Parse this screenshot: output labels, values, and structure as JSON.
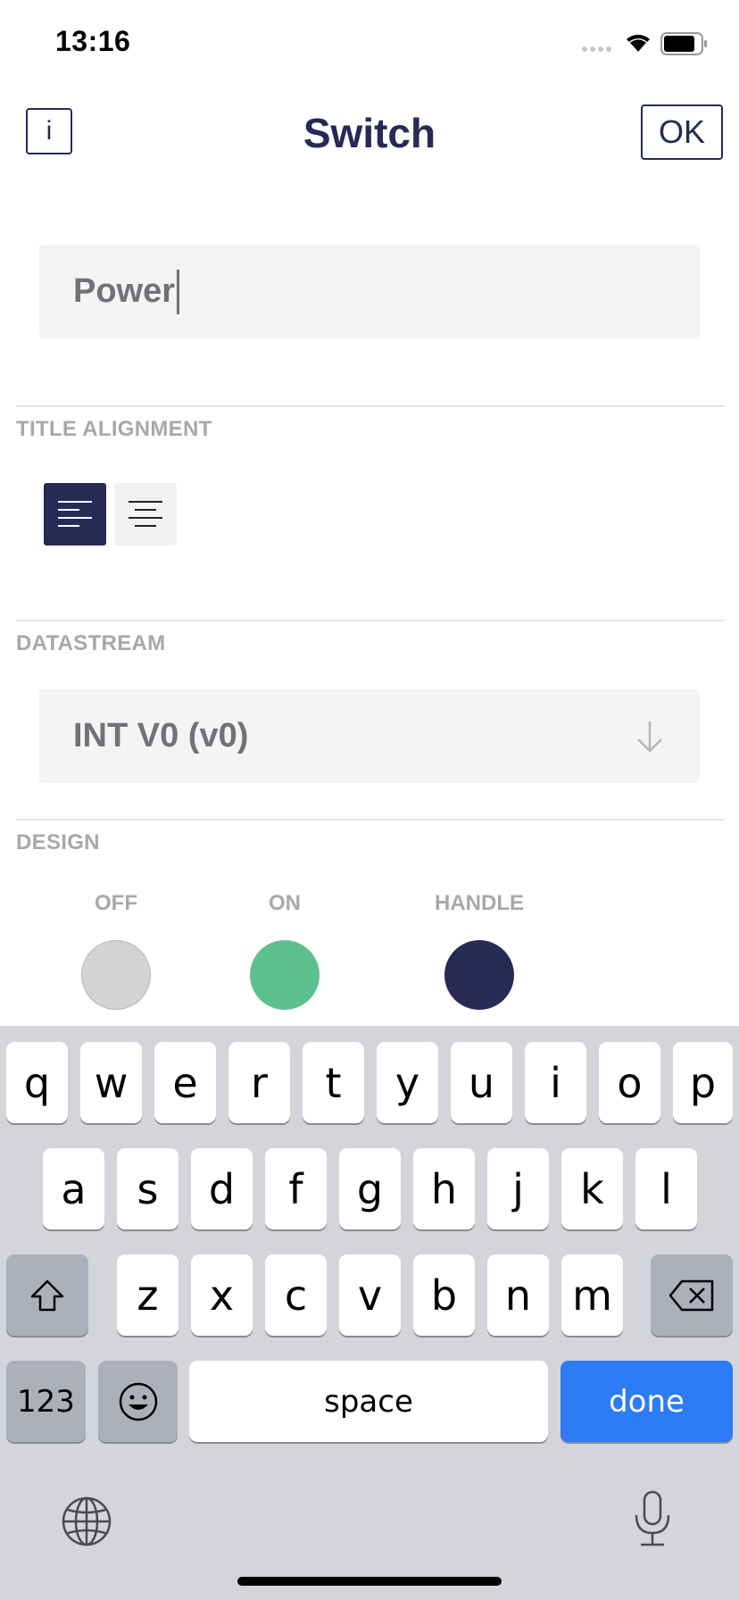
{
  "status_bar": {
    "time": "13:16"
  },
  "header": {
    "info_label": "i",
    "title": "Switch",
    "ok_label": "OK"
  },
  "title_field": {
    "value": "Power"
  },
  "title_alignment": {
    "label": "TITLE ALIGNMENT",
    "options": [
      "left",
      "center"
    ],
    "selected": "left"
  },
  "datastream": {
    "label": "DATASTREAM",
    "value": "INT V0 (v0)"
  },
  "design": {
    "label": "DESIGN",
    "swatches": [
      {
        "label": "OFF",
        "color": "#d3d3d3"
      },
      {
        "label": "ON",
        "color": "#5dc08e"
      },
      {
        "label": "HANDLE",
        "color": "#262a55"
      }
    ]
  },
  "keyboard": {
    "row1": [
      "q",
      "w",
      "e",
      "r",
      "t",
      "y",
      "u",
      "i",
      "o",
      "p"
    ],
    "row2": [
      "a",
      "s",
      "d",
      "f",
      "g",
      "h",
      "j",
      "k",
      "l"
    ],
    "row3": [
      "z",
      "x",
      "c",
      "v",
      "b",
      "n",
      "m"
    ],
    "numbers_label": "123",
    "space_label": "space",
    "done_label": "done"
  },
  "colors": {
    "accent": "#262a55",
    "done_blue": "#2d7bf5"
  }
}
